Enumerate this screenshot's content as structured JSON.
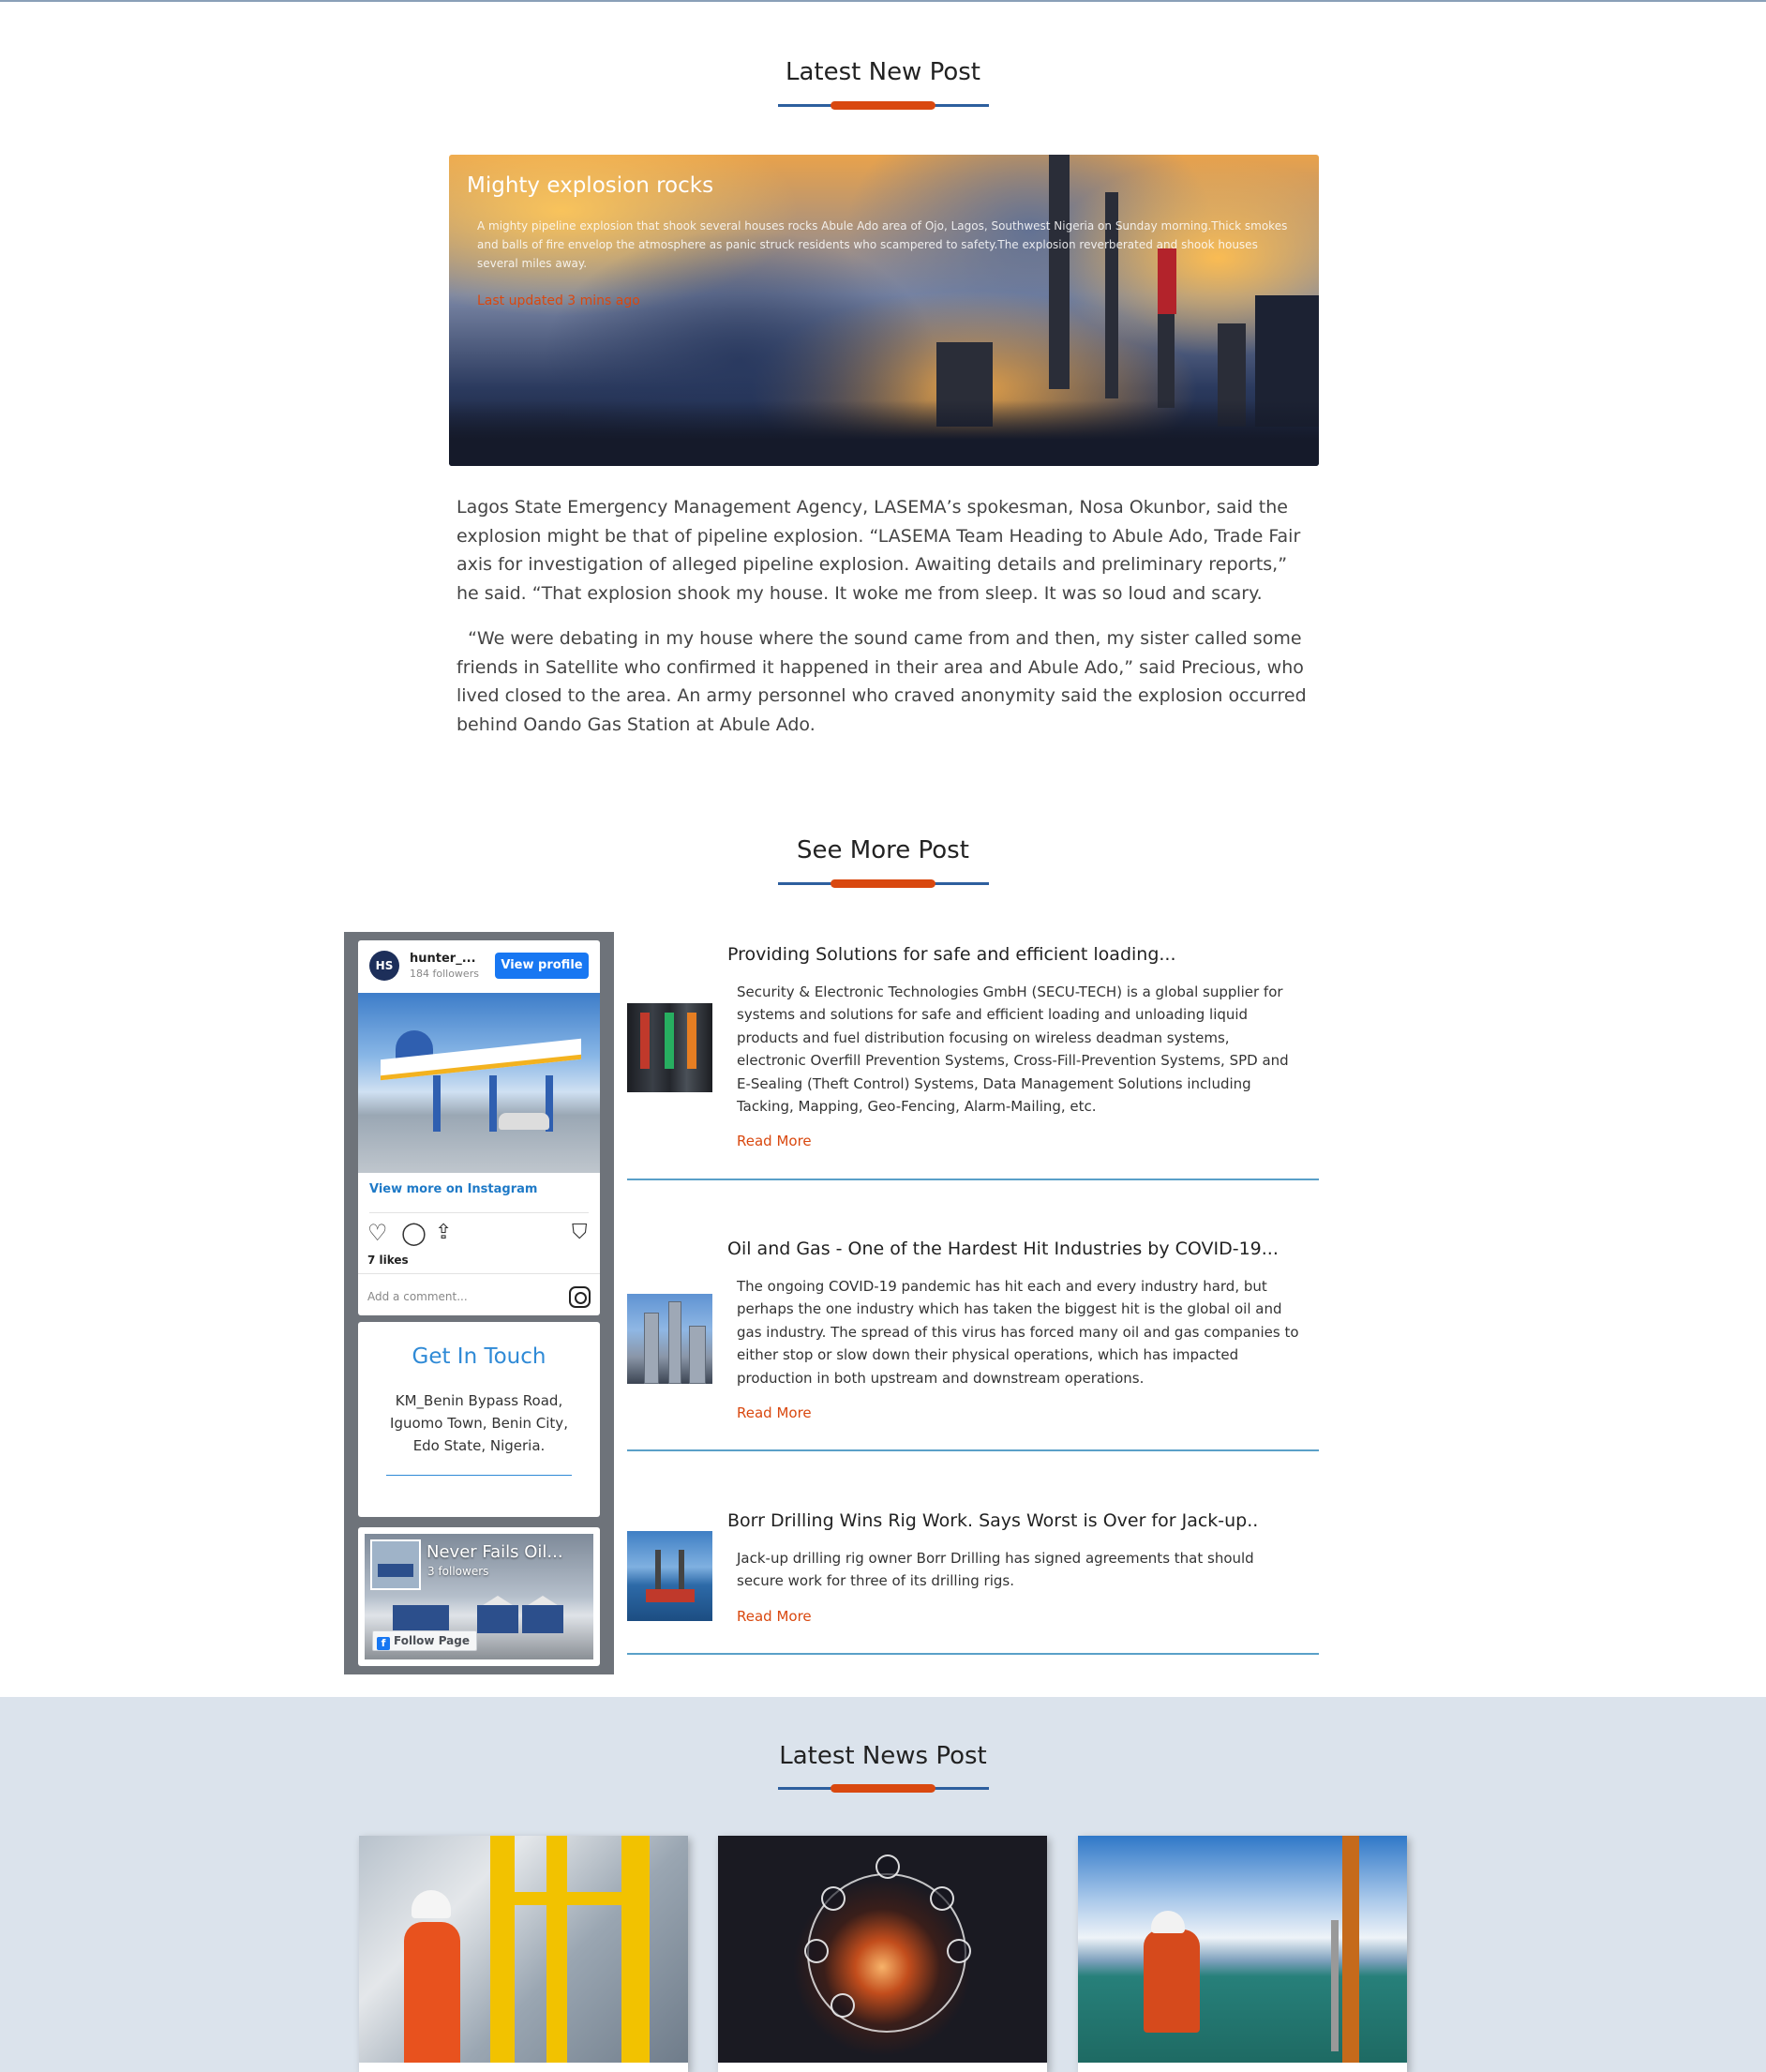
{
  "sections": {
    "latest_new_post": "Latest New Post",
    "see_more_post": "See More Post",
    "latest_news_post": "Latest News Post"
  },
  "hero": {
    "title": "Mighty explosion rocks",
    "text": "A mighty pipeline explosion that shook several houses rocks Abule Ado area of Ojo, Lagos, Southwest Nigeria on Sunday morning.Thick smokes and balls of fire envelop the atmosphere as panic struck residents who scampered to safety.The explosion reverberated and shook houses several miles away.",
    "updated": "Last updated 3 mins ago"
  },
  "article": {
    "paragraph1": "Lagos State Emergency Management Agency, LASEMA’s spokesman, Nosa Okunbor, said the explosion might be that of pipeline explosion. “LASEMA Team Heading to Abule Ado, Trade Fair axis for investigation of alleged pipeline explosion. Awaiting details and preliminary reports,” he said. “That explosion shook my house. It woke me from sleep. It was so loud and scary.",
    "paragraph2": "  “We were debating in my house where the sound came from and then, my sister called some friends in Satellite who confirmed it happened in their area and Abule Ado,” said Precious, who lived closed to the area. An army personnel who craved anonymity said the explosion occurred behind Oando Gas Station at Abule Ado."
  },
  "instagram": {
    "username": "hunter_...",
    "followers": "184 followers",
    "view_profile": "View profile",
    "view_more": "View more on Instagram",
    "likes": "7 likes",
    "comment_placeholder": "Add a comment...",
    "icons": [
      "heart-icon",
      "comment-icon",
      "share-icon",
      "bookmark-icon",
      "instagram-icon"
    ]
  },
  "contact": {
    "title": "Get In Touch",
    "address": "KM_Benin Bypass Road, Iguomo Town, Benin City, Edo State, Nigeria."
  },
  "facebook": {
    "page_name": "Never Fails Oil...",
    "followers": "3 followers",
    "follow_label": "Follow Page"
  },
  "posts": [
    {
      "title": "Providing Solutions for safe and efficient loading...",
      "text": "Security & Electronic Technologies GmbH (SECU-TECH) is a global supplier for systems and solutions for safe and efficient loading and unloading liquid products and fuel distribution focusing on wireless deadman systems, electronic Overfill Prevention Systems, Cross-Fill-Prevention Systems, SPD and E-Sealing (Theft Control) Systems, Data Management Solutions including Tacking, Mapping, Geo-Fencing, Alarm-Mailing, etc.",
      "read_more": "Read More"
    },
    {
      "title": "Oil and Gas - One of the Hardest Hit Industries by COVID-19...",
      "text": "The ongoing COVID-19 pandemic has hit each and every industry hard, but perhaps the one industry which has taken the biggest hit is the global oil and gas industry. The spread of this virus has forced many oil and gas companies to either stop or slow down their physical operations, which has impacted production in both upstream and downstream operations.",
      "read_more": "Read More"
    },
    {
      "title": "Borr Drilling Wins Rig Work. Says Worst is Over for Jack-up..",
      "text": "Jack-up drilling rig owner Borr Drilling has signed agreements that should secure work for three of its drilling rigs.",
      "read_more": "Read More"
    }
  ],
  "colors": {
    "accent": "#d9480f",
    "primary_blue": "#2d5f9e",
    "link_blue": "#2f8ad6",
    "news_band": "#dbe3ec"
  }
}
